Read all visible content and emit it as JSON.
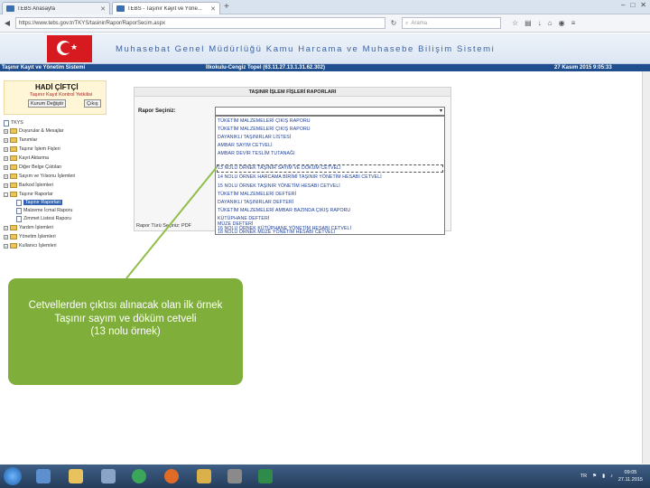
{
  "browser": {
    "tabs": [
      {
        "label": "TEBS Anasayfa"
      },
      {
        "label": "TEBS - Taşınır Kayıt ve Yöne..."
      }
    ],
    "url": "https://www.tebs.gov.tr/TKYS/tasinir/Rapor/RaporSecim.aspx",
    "search_placeholder": "Arama"
  },
  "site": {
    "banner_title": "Muhasebat Genel Müdürlüğü Kamu Harcama ve Muhasebe Bilişim Sistemi",
    "status_left": "Taşınır Kayıt ve Yönetim Sistemi",
    "status_center": "İlkokulu-Cengiz Topel (63.11.27.13.1.31.62.302)",
    "status_right": "27 Kasım 2015 9:05:33"
  },
  "user": {
    "name": "HADİ ÇİFTÇİ",
    "role": "Taşınır Kayıt Kontrol Yetkilisi",
    "change_button": "Kurum Değiştir",
    "logout_button": "Çıkış"
  },
  "tree": {
    "root": "TKYS",
    "items": [
      {
        "label": "Duyurular & Mesajlar",
        "type": "folder"
      },
      {
        "label": "Tanımlar",
        "type": "folder"
      },
      {
        "label": "Taşınır İşlem Fişleri",
        "type": "folder"
      },
      {
        "label": "Kayıt Aktarma",
        "type": "folder"
      },
      {
        "label": "Diğer Belge Çıktıları",
        "type": "folder"
      },
      {
        "label": "Sayım ve Yılsonu İşlemleri",
        "type": "folder"
      },
      {
        "label": "Barkod İşlemleri",
        "type": "folder"
      },
      {
        "label": "Taşınır Raporlar",
        "type": "folder"
      },
      {
        "label": "Taşınır Raporları",
        "type": "doc",
        "selected": true
      },
      {
        "label": "Malzeme İcmal Raporu",
        "type": "doc"
      },
      {
        "label": "Zimmet Listesi Raporu",
        "type": "doc"
      },
      {
        "label": "Yardım İşlemleri",
        "type": "folder"
      },
      {
        "label": "Yönetim İşlemleri",
        "type": "folder"
      },
      {
        "label": "Kullanıcı İşlemleri",
        "type": "folder"
      }
    ]
  },
  "reports": {
    "header": "TAŞINIR İŞLEM FİŞLERİ RAPORLARI",
    "select_label": "Rapor Seçiniz:",
    "selected_value": "",
    "footer_label": "Rapor Türü Seçiniz: PDF",
    "options": [
      "TÜKETİM MALZEMELERİ ÇIKIŞ RAPORU",
      "TÜKETİM MALZEMELERİ ÇIKIŞ RAPORU",
      "DAYANIKLI TAŞINIRLAR LİSTESİ",
      "AMBAR SAYIM CETVELİ",
      "AMBAR DEVİR TESLİM TUTANAĞI",
      "13 NOLU ÖRNEK TAŞINIR SAYIM VE DÖKÜM CETVELİ",
      "14 NOLU ÖRNEK HARCAMA BİRİMİ TAŞINIR YÖNETİM HESABI CETVELİ",
      "15 NOLU ÖRNEK TAŞINIR YÖNETİM HESABI CETVELİ",
      "TÜKETİM MALZEMELERİ DEFTERİ",
      "DAYANIKLI TAŞINIRLAR DEFTERİ",
      "TÜKETİM MALZEMELERİ AMBAR BAZINDA ÇIKIŞ RAPORU",
      "KÜTÜPHANE DEFTERİ",
      "MÜZE DEFTERİ",
      "16 NOLU ÖRNEK KÜTÜPHANE YÖNETİM HESABI CETVELİ",
      "18 NOLU ÖRNEK MÜZE YÖNETİM HESABI CETVELİ"
    ],
    "highlighted_index": 5
  },
  "callout": {
    "line1": "Cetvellerden çıktısı alınacak olan ilk örnek",
    "line2": "Taşınır sayım ve döküm cetveli",
    "line3": "(13 nolu örnek)"
  },
  "taskbar": {
    "tray_lang": "TR",
    "time": "09:05",
    "date": "27.11.2015"
  },
  "colors": {
    "accent": "#1f4f8f",
    "callout": "#7faf3a",
    "option_text": "#1a3d9a"
  }
}
